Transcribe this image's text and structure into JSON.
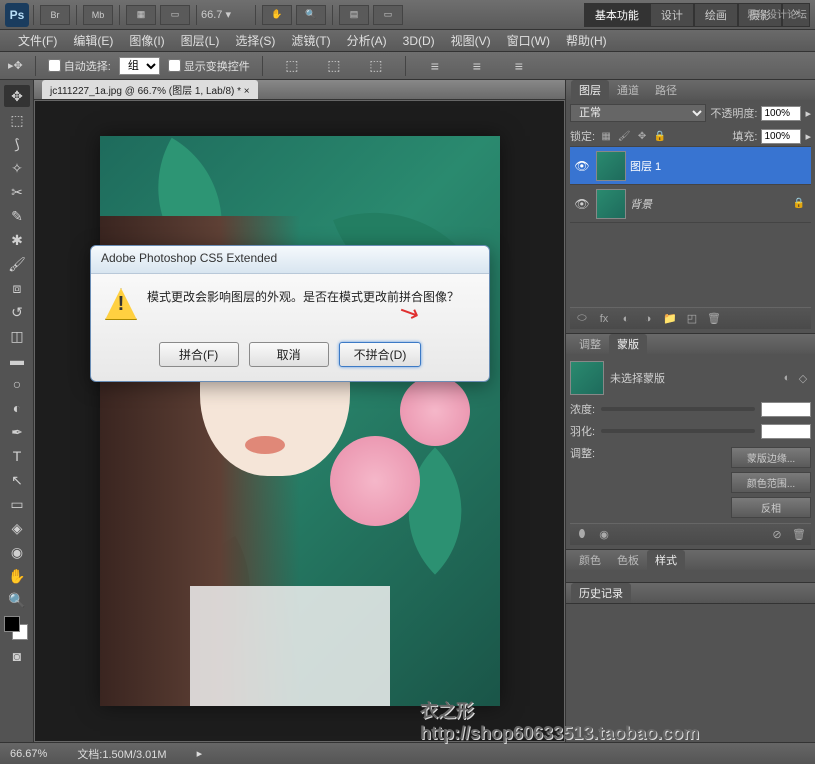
{
  "brand": {
    "name": "思缘设计论坛"
  },
  "top": {
    "ps": "Ps",
    "br": "Br",
    "mb": "Mb",
    "zoom": "66.7",
    "workspaces": [
      "基本功能",
      "设计",
      "绘画",
      "摄影"
    ]
  },
  "menu": {
    "items": [
      "文件(F)",
      "编辑(E)",
      "图像(I)",
      "图层(L)",
      "选择(S)",
      "滤镜(T)",
      "分析(A)",
      "3D(D)",
      "视图(V)",
      "窗口(W)",
      "帮助(H)"
    ]
  },
  "options": {
    "autoSelect": "自动选择:",
    "group": "组",
    "showTransform": "显示变换控件"
  },
  "doc": {
    "tab": "jc111227_1a.jpg @ 66.7% (图层 1, Lab/8) *"
  },
  "dialog": {
    "title": "Adobe Photoshop CS5 Extended",
    "message": "模式更改会影响图层的外观。是否在模式更改前拼合图像？",
    "btnMerge": "拼合(F)",
    "btnCancel": "取消",
    "btnDontMerge": "不拼合(D)"
  },
  "layers": {
    "tabs": [
      "图层",
      "通道",
      "路径"
    ],
    "blend": "正常",
    "opacityLabel": "不透明度:",
    "opacity": "100%",
    "lockLabel": "锁定:",
    "fillLabel": "填充:",
    "fill": "100%",
    "items": [
      {
        "name": "图层 1",
        "locked": false
      },
      {
        "name": "背景",
        "locked": true
      }
    ]
  },
  "adjust": {
    "tabs": [
      "调整",
      "蒙版"
    ],
    "noMask": "未选择蒙版",
    "density": "浓度:",
    "feather": "羽化:",
    "refine": "调整:",
    "maskEdge": "蒙版边缘...",
    "colorRange": "颜色范围...",
    "invert": "反相"
  },
  "history": {
    "tabs": [
      "颜色",
      "色板",
      "样式"
    ],
    "historyLabel": "历史记录"
  },
  "status": {
    "zoom": "66.67%",
    "docLabel": "文档:",
    "docSize": "1.50M/3.01M"
  },
  "watermark": {
    "line1": "衣之形",
    "line2": "http://shop60633513.taobao.com"
  }
}
